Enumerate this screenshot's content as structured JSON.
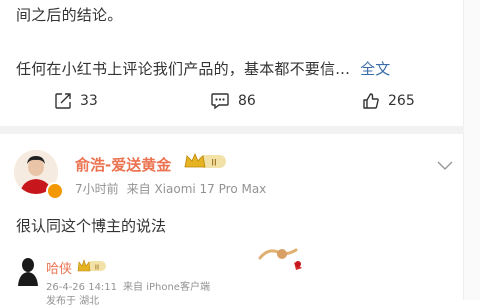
{
  "post": {
    "line1": "间之后的结论。",
    "line2": "任何在小红书上评论我们产品的，基本都不要信...",
    "full_text_link": "全文"
  },
  "actions": {
    "repost_count": "33",
    "comment_count": "86",
    "like_count": "265"
  },
  "comment": {
    "author": "俞浩-爱送黄金",
    "level_badge": "II",
    "time": "7小时前",
    "source": "来自 Xiaomi 17 Pro Max",
    "content": "很认同这个博主的说法"
  },
  "reply": {
    "author": "哈侠",
    "level_badge": "II",
    "time": "26-4-26 14:11",
    "source": "来自 iPhone客户端",
    "location": "发布于 湖北"
  },
  "colors": {
    "name_orange": "#eb7350",
    "link_blue": "#3b6ea8",
    "meta_gray": "#939393",
    "vip_gold": "#e6b422"
  }
}
